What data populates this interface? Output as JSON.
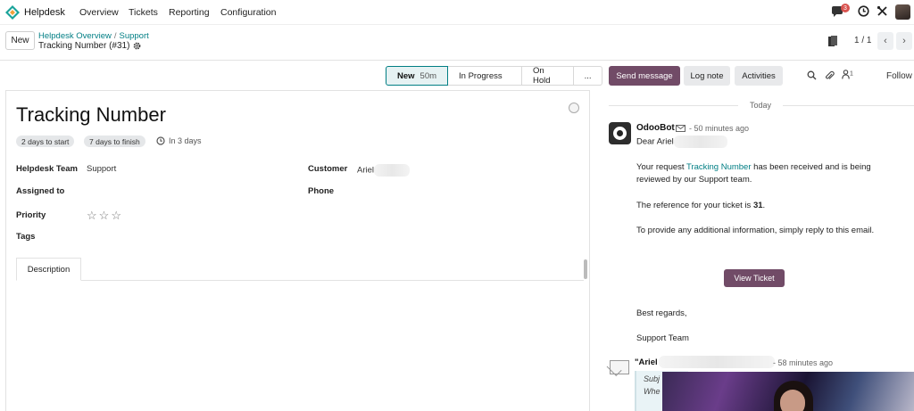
{
  "app": {
    "name": "Helpdesk",
    "nav": [
      "Overview",
      "Tickets",
      "Reporting",
      "Configuration"
    ],
    "notification_count": "3"
  },
  "control_panel": {
    "new_label": "New",
    "breadcrumb": [
      "Helpdesk Overview",
      "Support"
    ],
    "record_title": "Tracking Number (#31)",
    "pager": "1 / 1"
  },
  "stages": [
    {
      "label": "New",
      "duration": "50m",
      "active": true
    },
    {
      "label": "In Progress"
    },
    {
      "label": "On Hold"
    },
    {
      "label": "..."
    }
  ],
  "form": {
    "title": "Tracking Number",
    "badges": [
      "2 days to start",
      "7 days to finish"
    ],
    "deadline": "In 3 days",
    "fields": {
      "team_label": "Helpdesk Team",
      "team_value": "Support",
      "assigned_label": "Assigned to",
      "priority_label": "Priority",
      "tags_label": "Tags",
      "customer_label": "Customer",
      "customer_value": "Ariel",
      "phone_label": "Phone"
    },
    "priority_stars": 0,
    "tab": "Description"
  },
  "chatter": {
    "send_message": "Send message",
    "log_note": "Log note",
    "activities": "Activities",
    "followers_count": "1",
    "follow": "Follow",
    "date_separator": "Today",
    "message": {
      "author": "OdooBot",
      "time": "- 50 minutes ago",
      "greeting": "Dear Ariel",
      "line1_pre": "Your request ",
      "line1_link": "Tracking Number",
      "line1_post": " has been received and is being reviewed by our Support team.",
      "line2_pre": "The reference for your ticket is ",
      "line2_ref": "31",
      "line2_post": ".",
      "line3": "To provide any additional information, simply reply to this email.",
      "button": "View Ticket",
      "regards": "Best regards,",
      "signature": "Support Team"
    },
    "message2": {
      "author": "\"Ariel",
      "time": "- 58 minutes ago",
      "subject_fragment": "Subj",
      "body_fragment": "Whe"
    }
  },
  "colors": {
    "brand": "#714b67",
    "link": "#017e84",
    "badge_red": "#d9534f"
  }
}
